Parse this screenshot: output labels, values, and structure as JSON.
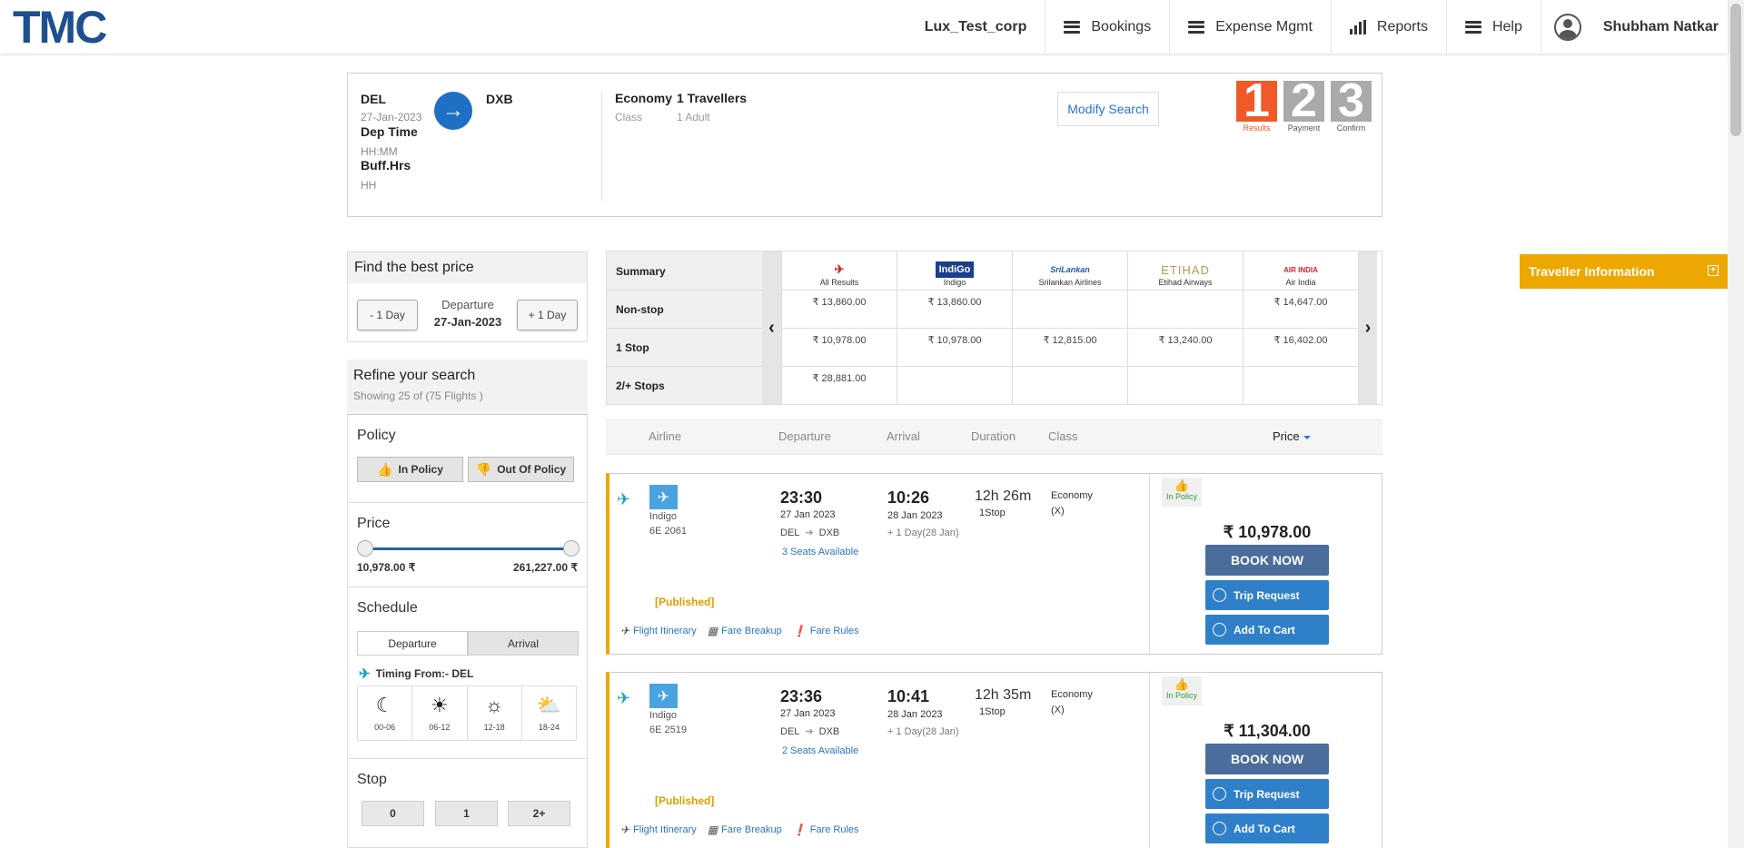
{
  "nav": {
    "logo": "TMC",
    "corp": "Lux_Test_corp",
    "items": [
      {
        "label": "Bookings",
        "icon": "menu-icon"
      },
      {
        "label": "Expense Mgmt",
        "icon": "menu-icon"
      },
      {
        "label": "Reports",
        "icon": "bar-chart-icon"
      },
      {
        "label": "Help",
        "icon": "menu-icon"
      }
    ],
    "user": "Shubham Natkar"
  },
  "search": {
    "from": "DEL",
    "date": "27-Jan-2023",
    "dep_time_label": "Dep Time",
    "dep_time_placeholder": "HH:MM",
    "buff_label": "Buff.Hrs",
    "buff_placeholder": "HH",
    "to": "DXB",
    "class": "Economy",
    "class_label": "Class",
    "travellers": "1 Travellers",
    "adults": "1 Adult",
    "modify": "Modify Search",
    "steps": [
      {
        "num": "1",
        "label": "Results"
      },
      {
        "num": "2",
        "label": "Payment"
      },
      {
        "num": "3",
        "label": "Confirm"
      }
    ]
  },
  "best_price": {
    "title": "Find the best price",
    "minus": "- 1 Day",
    "plus": "+ 1 Day",
    "departure_label": "Departure",
    "departure_date": "27-Jan-2023"
  },
  "refine": {
    "title": "Refine your search",
    "subtitle": "Showing 25 of (75 Flights )"
  },
  "filters": {
    "policy_title": "Policy",
    "in_policy": "In Policy",
    "out_policy": "Out Of Policy",
    "price_title": "Price",
    "price_min": "10,978.00 ₹",
    "price_max": "261,227.00 ₹",
    "schedule_title": "Schedule",
    "departure": "Departure",
    "arrival": "Arrival",
    "timing": "Timing From:- DEL",
    "slots": [
      "00-06",
      "06-12",
      "12-18",
      "18-24"
    ],
    "stop_title": "Stop",
    "stops": [
      "0",
      "1",
      "2+"
    ]
  },
  "matrix": {
    "rows": [
      "Summary",
      "Non-stop",
      "1 Stop",
      "2/+ Stops"
    ],
    "airlines": [
      {
        "logo": "✈",
        "name": "All Results",
        "values": [
          "₹ 13,860.00",
          "₹ 10,978.00",
          "₹ 28,881.00"
        ]
      },
      {
        "logo": "IndiGo",
        "name": "Indigo",
        "values": [
          "₹ 13,860.00",
          "₹ 10,978.00",
          ""
        ]
      },
      {
        "logo": "SriLankan",
        "name": "Srilankan Airlines",
        "values": [
          "",
          "₹ 12,815.00",
          ""
        ]
      },
      {
        "logo": "ETIHAD",
        "name": "Etihad Airways",
        "values": [
          "",
          "₹ 13,240.00",
          ""
        ]
      },
      {
        "logo": "AIR INDIA",
        "name": "Air India",
        "values": [
          "₹ 14,647.00",
          "₹ 16,402.00",
          ""
        ]
      }
    ]
  },
  "list_header": {
    "airline": "Airline",
    "departure": "Departure",
    "arrival": "Arrival",
    "duration": "Duration",
    "class": "Class",
    "price": "Price"
  },
  "flights": [
    {
      "airline": "Indigo",
      "code": "6E  2061",
      "dep_time": "23:30",
      "dep_date": "27 Jan 2023",
      "from": "DEL",
      "to": "DXB",
      "seats": "3 Seats Available",
      "arr_time": "10:26",
      "arr_date": "28 Jan 2023",
      "plus_day": "+ 1 Day(28 Jan)",
      "duration": "12h 26m",
      "stops": "1Stop",
      "class": "Economy",
      "class_code": "(X)",
      "fare_type": "[Published]",
      "policy": "In Policy",
      "price": "₹ 10,978.00",
      "book": "BOOK NOW",
      "trip_request": "Trip Request",
      "add_cart": "Add To Cart",
      "links": [
        "Flight Itinerary",
        "Fare Breakup",
        "Fare Rules"
      ]
    },
    {
      "airline": "Indigo",
      "code": "6E  2519",
      "dep_time": "23:36",
      "dep_date": "27 Jan 2023",
      "from": "DEL",
      "to": "DXB",
      "seats": "2 Seats Available",
      "arr_time": "10:41",
      "arr_date": "28 Jan 2023",
      "plus_day": "+ 1 Day(28 Jan)",
      "duration": "12h 35m",
      "stops": "1Stop",
      "class": "Economy",
      "class_code": "(X)",
      "fare_type": "[Published]",
      "policy": "In Policy",
      "price": "₹ 11,304.00",
      "book": "BOOK NOW",
      "trip_request": "Trip Request",
      "add_cart": "Add To Cart",
      "links": [
        "Flight Itinerary",
        "Fare Breakup",
        "Fare Rules"
      ]
    }
  ],
  "traveller_panel": {
    "title": "Traveller Information",
    "toggle": "⊞"
  },
  "colors": {
    "brand": "#1e4f8f",
    "accent": "#2a74c5",
    "policy_green": "#2e9c3b",
    "card_border": "#f0a500",
    "traveller_bg": "#eda800"
  }
}
